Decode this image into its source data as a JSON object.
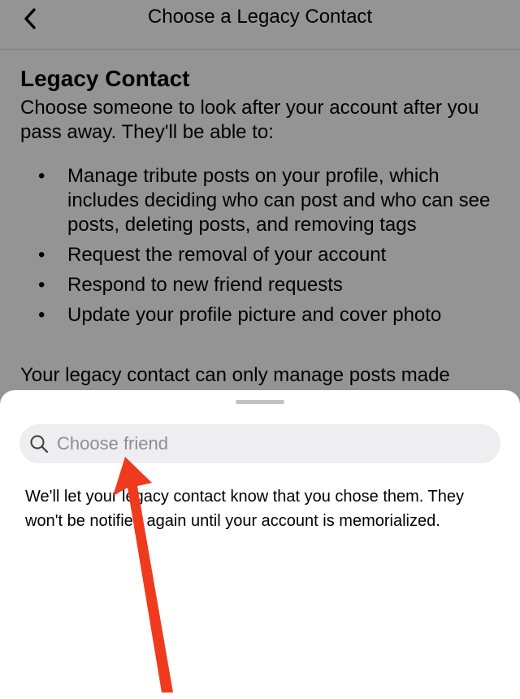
{
  "header": {
    "title": "Choose a Legacy Contact",
    "back_icon": "chevron-left-icon"
  },
  "content": {
    "section_title": "Legacy Contact",
    "intro": "Choose someone to look after your account after you pass away. They'll be able to:",
    "bullet_symbol": "•",
    "bullets": [
      "Manage tribute posts on your profile, which includes deciding who can post and who can see posts, deleting posts, and removing tags",
      "Request the removal of your account",
      "Respond to new friend requests",
      "Update your profile picture and cover photo"
    ],
    "more": "Your legacy contact can only manage posts made"
  },
  "sheet": {
    "search": {
      "placeholder": "Choose friend",
      "value": "",
      "icon": "search-icon"
    },
    "note": "We'll let your legacy contact know that you chose them. They won't be notified again until your account is memorialized."
  },
  "annotation": {
    "color": "#f03a1e",
    "icon": "red-arrow-annotation"
  }
}
